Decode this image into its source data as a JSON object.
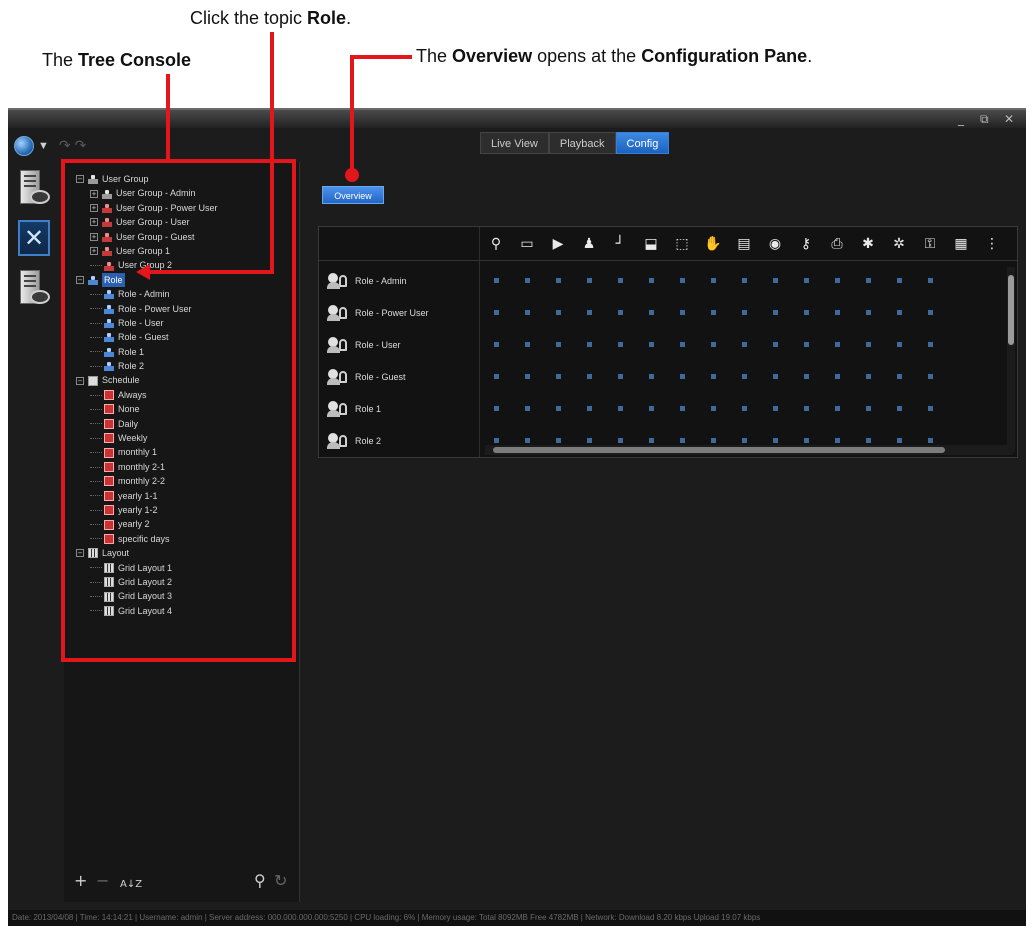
{
  "annotations": {
    "click_role": {
      "prefix": "Click the topic ",
      "bold": "Role",
      "suffix": "."
    },
    "tree_console": {
      "prefix": "The ",
      "bold": "Tree Console"
    },
    "overview": {
      "prefix": "The ",
      "bold1": "Overview",
      "mid": " opens at the ",
      "bold2": "Configuration Pane",
      "suffix": "."
    }
  },
  "window": {
    "minimize": "_",
    "restore": "⧉",
    "close": "✕"
  },
  "tabs": [
    {
      "label": "Live View"
    },
    {
      "label": "Playback"
    },
    {
      "label": "Config"
    }
  ],
  "tree": {
    "user_group": {
      "label": "User Group",
      "children": [
        "User Group - Admin",
        "User Group - Power User",
        "User Group - User",
        "User Group - Guest",
        "User Group 1",
        "User Group 2"
      ]
    },
    "role": {
      "label": "Role",
      "children": [
        "Role - Admin",
        "Role - Power User",
        "Role - User",
        "Role - Guest",
        "Role 1",
        "Role 2"
      ]
    },
    "schedule": {
      "label": "Schedule",
      "children": [
        "Always",
        "None",
        "Daily",
        "Weekly",
        "monthly 1",
        "monthly 2-1",
        "monthly 2-2",
        "yearly 1-1",
        "yearly 1-2",
        "yearly 2",
        "specific days"
      ]
    },
    "layout": {
      "label": "Layout",
      "children": [
        "Grid Layout 1",
        "Grid Layout 2",
        "Grid Layout 3",
        "Grid Layout 4"
      ]
    }
  },
  "overview_button": "Overview",
  "role_rows": [
    "Role - Admin",
    "Role - Power User",
    "Role - User",
    "Role - Guest",
    "Role 1",
    "Role 2"
  ],
  "column_icons": [
    "⚲",
    "▭",
    "▶",
    "♟",
    "┘",
    "⬓",
    "⬚",
    "✋",
    "▤",
    "◉",
    "⚷",
    "⎙",
    "✱",
    "✲",
    "⚿",
    "▦",
    "⋮"
  ],
  "tree_tools": {
    "add": "+",
    "remove": "−",
    "sort": "A↓Z",
    "search": "⚲",
    "refresh": "↻"
  },
  "status_bar": "Date: 2013/04/08  |  Time: 14:14:21  |  Username: admin  |  Server address: 000.000.000.000:5250  |  CPU loading: 6%  |  Memory usage: Total 8092MB  Free 4782MB  |  Network: Download  8.20 kbps Upload  19.07 kbps",
  "colors": {
    "accent": "#e2161b",
    "active_tab": "#2a74d4",
    "selected": "#2b5fb0"
  }
}
